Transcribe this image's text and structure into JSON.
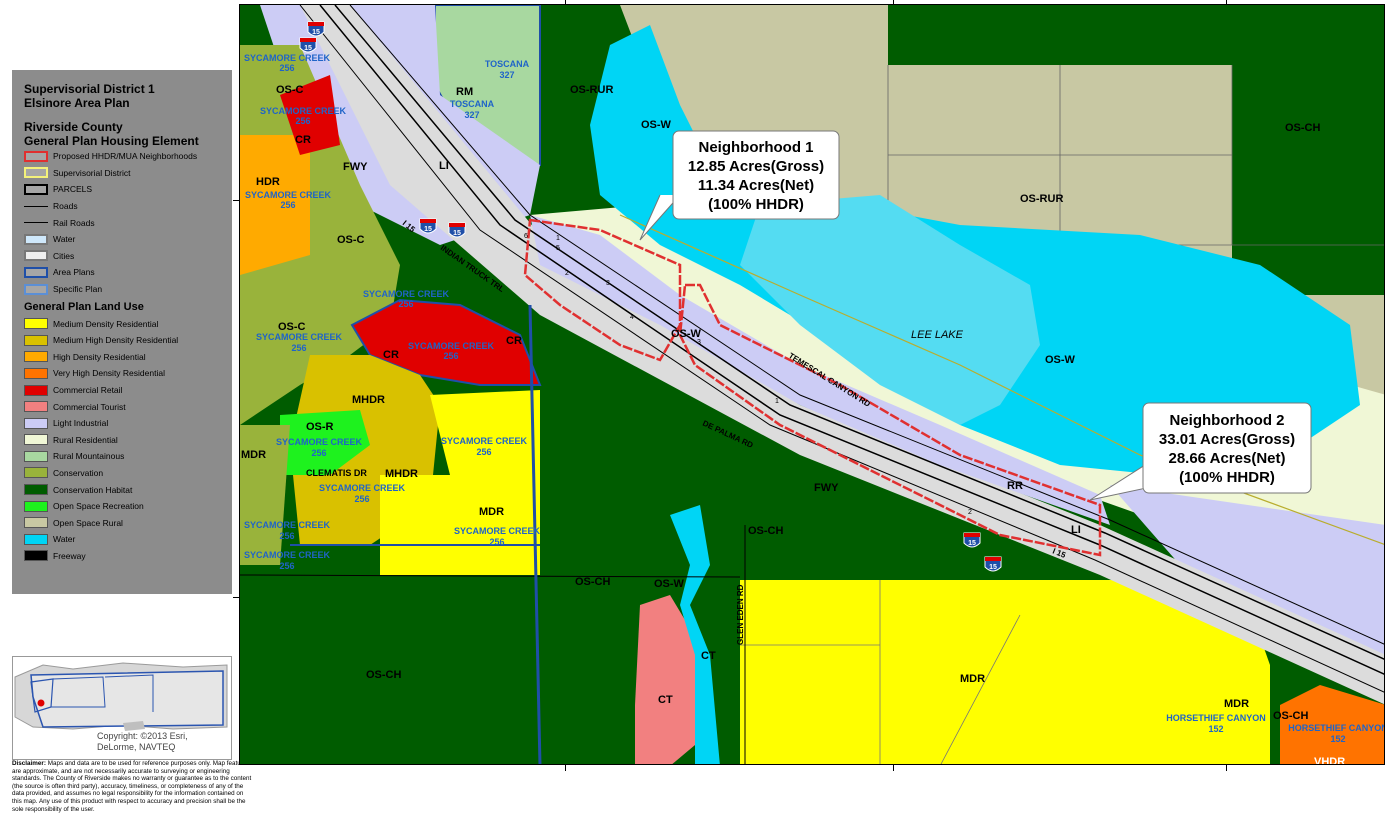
{
  "legend": {
    "title_line1": "Supervisorial District 1",
    "title_line2": "Elsinore Area Plan",
    "subtitle_line1": "Riverside County",
    "subtitle_line2": "General Plan Housing Element",
    "reference_items": [
      {
        "label": "Proposed HHDR/MUA Neighborhoods",
        "fill": "#a6a6a6",
        "stroke": "#e03030"
      },
      {
        "label": "Supervisorial District",
        "fill": "#a6a6a6",
        "stroke": "#f4f27a"
      },
      {
        "label": "PARCELS",
        "fill": "#a6a6a6",
        "stroke": "#000000"
      },
      {
        "label": "Roads",
        "fill": "none",
        "stroke": "#000000"
      },
      {
        "label": "Rail Roads",
        "fill": "none",
        "stroke": "#000000"
      },
      {
        "label": "Water",
        "fill": "#cfe8fb",
        "stroke": "#777777"
      },
      {
        "label": "Cities",
        "fill": "#eeeeee",
        "stroke": "#777777"
      },
      {
        "label": "Area Plans",
        "fill": "#a6a6a6",
        "stroke": "#1f4fa8"
      },
      {
        "label": "Specific Plan",
        "fill": "#a6a6a6",
        "stroke": "#5b8fd6"
      }
    ],
    "land_use_title": "General Plan Land Use",
    "land_use_items": [
      {
        "label": "Medium Density Residential",
        "color": "#ffff00"
      },
      {
        "label": "Medium High Density Residential",
        "color": "#d9c100"
      },
      {
        "label": "High Density Residential",
        "color": "#ffaa00"
      },
      {
        "label": "Very High Density Residential",
        "color": "#ff7300"
      },
      {
        "label": "Commercial Retail",
        "color": "#e00000"
      },
      {
        "label": "Commercial Tourist",
        "color": "#f28080"
      },
      {
        "label": "Light Industrial",
        "color": "#ccccf5"
      },
      {
        "label": "Rural Residential",
        "color": "#f0f7d6"
      },
      {
        "label": "Rural Mountainous",
        "color": "#a8d8a0"
      },
      {
        "label": "Conservation",
        "color": "#99b33b"
      },
      {
        "label": "Conservation Habitat",
        "color": "#005c00"
      },
      {
        "label": "Open Space Recreation",
        "color": "#1ef21e"
      },
      {
        "label": "Open Space Rural",
        "color": "#c8c8a3"
      },
      {
        "label": "Water",
        "color": "#00d5f5"
      },
      {
        "label": "Freeway",
        "color": "#000000"
      }
    ]
  },
  "locator": {
    "copyright_line1": "Copyright: ©2013 Esri,",
    "copyright_line2": "DeLorme, NAVTEQ"
  },
  "disclaimer": {
    "lead": "Disclaimer:",
    "text": "Maps and data are to be used for reference purposes only. Map features are approximate, and are not necessarily accurate to surveying or engineering standards. The County of Riverside makes no warranty or guarantee as to the content (the source is often third party), accuracy, timeliness, or completeness of any of the data provided, and assumes no legal responsibility for the information contained on this map. Any use of this product with respect to accuracy and precision shall be the sole responsibility of the user."
  },
  "map": {
    "callouts": {
      "n1_line1": "Neighborhood 1",
      "n1_line2": "12.85 Acres(Gross)",
      "n1_line3": "11.34 Acres(Net)",
      "n1_line4": "(100% HHDR)",
      "n2_line1": "Neighborhood 2",
      "n2_line2": "33.01 Acres(Gross)",
      "n2_line3": "28.66 Acres(Net)",
      "n2_line4": "(100% HHDR)"
    },
    "zone_labels": {
      "os_rur_1": "OS-RUR",
      "os_rur_2": "OS-RUR",
      "os_w_1": "OS-W",
      "os_w_2": "OS-W",
      "os_w_3": "OS-W",
      "os_w_small": "OS-W",
      "os_ch_1": "OS-CH",
      "os_ch_2": "OS-CH",
      "os_ch_3": "OS-CH",
      "os_ch_4": "OS-CH",
      "os_c_1": "OS-C",
      "os_c_2": "OS-C",
      "os_c_3": "OS-C",
      "os_r": "OS-R",
      "rm": "RM",
      "li_1": "LI",
      "li_2": "LI",
      "cr_1": "CR",
      "cr_2": "CR",
      "cr_3": "CR",
      "hdr": "HDR",
      "mhdr_1": "MHDR",
      "mhdr_2": "MHDR",
      "mdr_1": "MDR",
      "mdr_2": "MDR",
      "mdr_3": "MDR",
      "mdr_4": "MDR",
      "ct_1": "CT",
      "ct_2": "CT",
      "rr": "RR",
      "fwy_1": "FWY",
      "fwy_2": "FWY",
      "vhdr": "VHDR",
      "lee_lake": "LEE LAKE"
    },
    "specific_plans": {
      "toscana_a": "TOSCANA",
      "toscana_a_num": "327",
      "toscana_b": "TOSCANA",
      "toscana_b_num": "327",
      "syc_1": "SYCAMORE CREEK",
      "syc_1_num": "256",
      "syc_2": "SYCAMORE CREEK",
      "syc_2_num": "256",
      "syc_3": "SYCAMORE CREEK",
      "syc_3_num": "256",
      "syc_4": "SYCAMORE CREEK",
      "syc_4_num": "256",
      "syc_5": "SYCAMORE CREEK",
      "syc_5_num": "256",
      "syc_6": "SYCAMORE CREEK",
      "syc_6_num": "256",
      "syc_7": "SYCAMORE CREEK",
      "syc_7_num": "256",
      "syc_8": "SYCAMORE CREEK",
      "syc_8_num": "256",
      "syc_9": "SYCAMORE CREEK",
      "syc_9_num": "256",
      "syc_10": "SYCAMORE CREEK",
      "syc_10_num": "256",
      "syc_11": "SYCAMORE CREEK",
      "syc_11_num": "256",
      "syc_12": "SYCAMORE CREEK",
      "syc_12_num": "256",
      "horse_1": "HORSETHIEF CANYON",
      "horse_1_num": "152",
      "horse_2": "HORSETHIEF CANYON",
      "horse_2_num": "152"
    },
    "roads": {
      "indian_truck": "INDIAN TRUCK TRL",
      "temescal": "TEMESCAL CANYON RD",
      "de_palma": "DE PALMA RD",
      "glen_eden": "GLEN EDEN RD",
      "clematis": "CLEMATIS DR",
      "i15_a": "I 15",
      "i15_b": "I 15"
    },
    "parcels": [
      "1",
      "2",
      "3",
      "4",
      "5",
      "6",
      "1",
      "2",
      "3"
    ],
    "shields": [
      "15",
      "15",
      "15",
      "15",
      "15",
      "15"
    ]
  }
}
